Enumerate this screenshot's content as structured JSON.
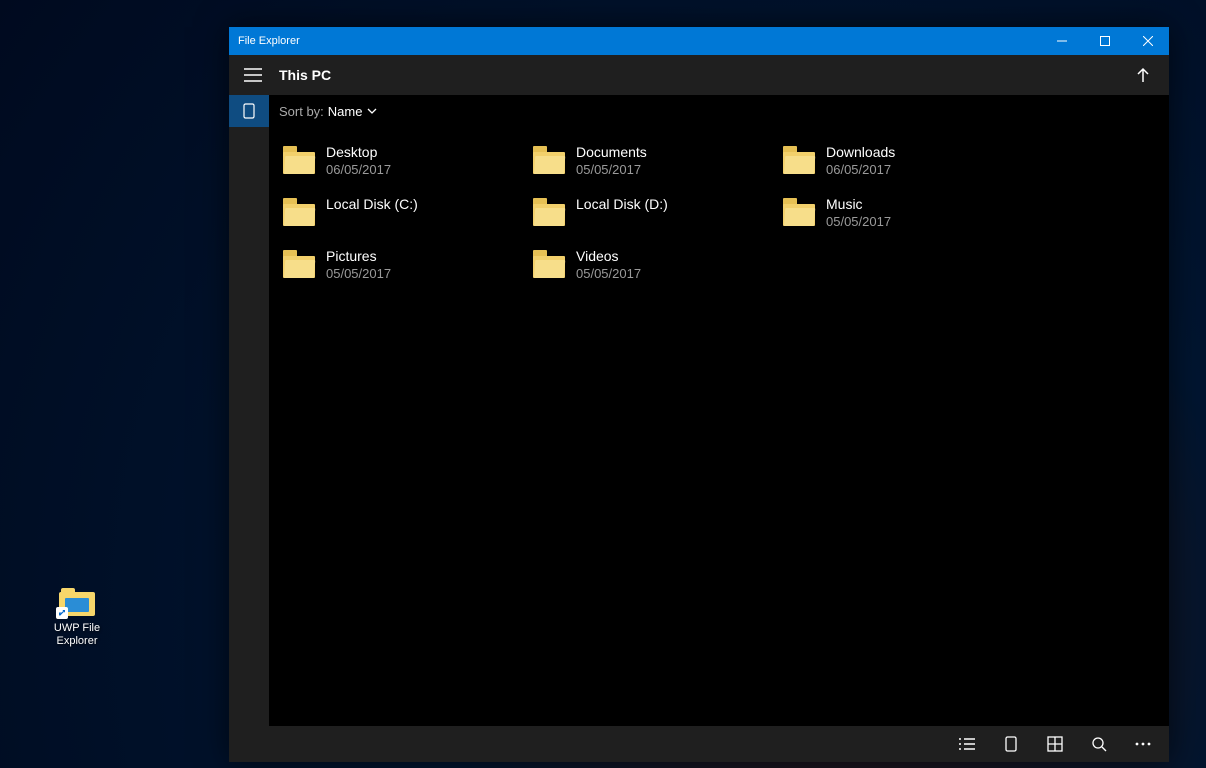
{
  "desktop": {
    "icon_label_line1": "UWP File",
    "icon_label_line2": "Explorer"
  },
  "window": {
    "title": "File Explorer",
    "location": "This PC"
  },
  "sort": {
    "label": "Sort by:",
    "value": "Name"
  },
  "items": [
    {
      "name": "Desktop",
      "date": "06/05/2017"
    },
    {
      "name": "Documents",
      "date": "05/05/2017"
    },
    {
      "name": "Downloads",
      "date": "06/05/2017"
    },
    {
      "name": "Local Disk (C:)",
      "date": ""
    },
    {
      "name": "Local Disk (D:)",
      "date": ""
    },
    {
      "name": "Music",
      "date": "05/05/2017"
    },
    {
      "name": "Pictures",
      "date": "05/05/2017"
    },
    {
      "name": "Videos",
      "date": "05/05/2017"
    }
  ]
}
